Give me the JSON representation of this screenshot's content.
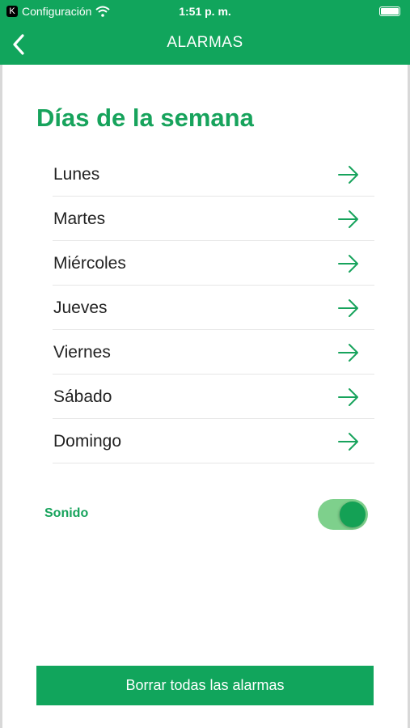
{
  "status_bar": {
    "back_app_glyph": "K",
    "back_app_label": "Configuración",
    "time": "1:51 p. m.",
    "icons": [
      "wifi-icon",
      "battery-icon"
    ]
  },
  "nav": {
    "title": "ALARMAS",
    "back_icon": "chevron-left-icon"
  },
  "section": {
    "title": "Días de la semana"
  },
  "days": [
    {
      "label": "Lunes",
      "icon": "arrow-right-icon"
    },
    {
      "label": "Martes",
      "icon": "arrow-right-icon"
    },
    {
      "label": "Miércoles",
      "icon": "arrow-right-icon"
    },
    {
      "label": "Jueves",
      "icon": "arrow-right-icon"
    },
    {
      "label": "Viernes",
      "icon": "arrow-right-icon"
    },
    {
      "label": "Sábado",
      "icon": "arrow-right-icon"
    },
    {
      "label": "Domingo",
      "icon": "arrow-right-icon"
    }
  ],
  "sound": {
    "label": "Sonido",
    "enabled": true
  },
  "actions": {
    "clear_all_label": "Borrar todas las alarmas"
  },
  "colors": {
    "brand_green": "#11a55c",
    "accent_green": "#17a35c",
    "toggle_track": "#7ed08c"
  }
}
